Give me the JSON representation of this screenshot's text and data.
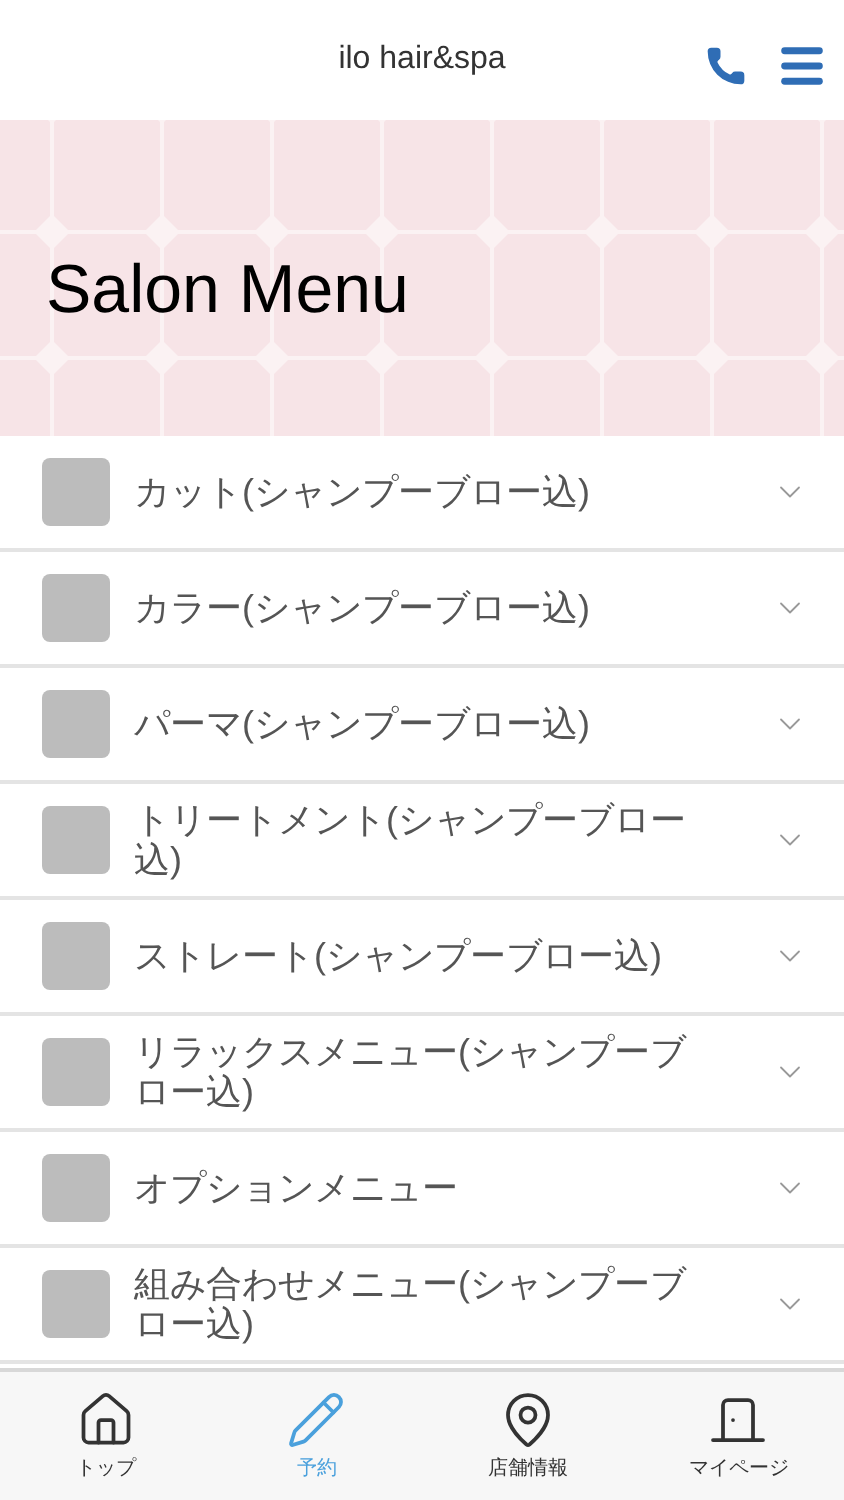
{
  "header": {
    "title": "ilo hair&spa"
  },
  "banner": {
    "title": "Salon Menu"
  },
  "menu_items": [
    {
      "label": "カット(シャンプーブロー込)",
      "expanded": false
    },
    {
      "label": "カラー(シャンプーブロー込)",
      "expanded": false
    },
    {
      "label": "パーマ(シャンプーブロー込)",
      "expanded": false
    },
    {
      "label": "トリートメント(シャンプーブロー込)",
      "expanded": false
    },
    {
      "label": "ストレート(シャンプーブロー込)",
      "expanded": false
    },
    {
      "label": "リラックスメニュー(シャンプーブロー込)",
      "expanded": false
    },
    {
      "label": "オプションメニュー",
      "expanded": false
    },
    {
      "label": "組み合わせメニュー(シャンプーブロー込)",
      "expanded": false
    }
  ],
  "tab_bar": [
    {
      "label": "トップ",
      "kind": "home",
      "selected": false
    },
    {
      "label": "予約",
      "kind": "reserve",
      "selected": true
    },
    {
      "label": "店舗情報",
      "kind": "shop",
      "selected": false
    },
    {
      "label": "マイページ",
      "kind": "mypage",
      "selected": false
    }
  ]
}
